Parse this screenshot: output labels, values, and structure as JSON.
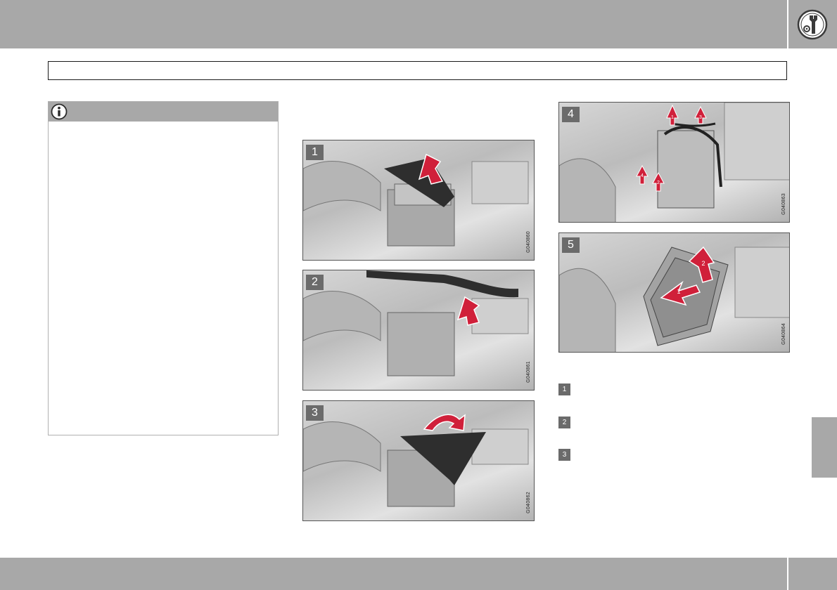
{
  "figures": [
    {
      "number": "1",
      "code": "G040860"
    },
    {
      "number": "2",
      "code": "G040861"
    },
    {
      "number": "3",
      "code": "G040862"
    },
    {
      "number": "4",
      "code": "G040863"
    },
    {
      "number": "5",
      "code": "G040864"
    }
  ],
  "fig4_callouts": [
    "1",
    "3",
    "4",
    "2"
  ],
  "fig5_callouts": [
    "1",
    "2"
  ],
  "step_list": [
    "1",
    "2",
    "3"
  ],
  "colors": {
    "accent_red": "#d0203a",
    "bar_gray": "#a8a8a8",
    "marker_gray": "#6b6b6b"
  },
  "icons": {
    "header": "wrench-gear-icon",
    "note": "info-icon"
  }
}
